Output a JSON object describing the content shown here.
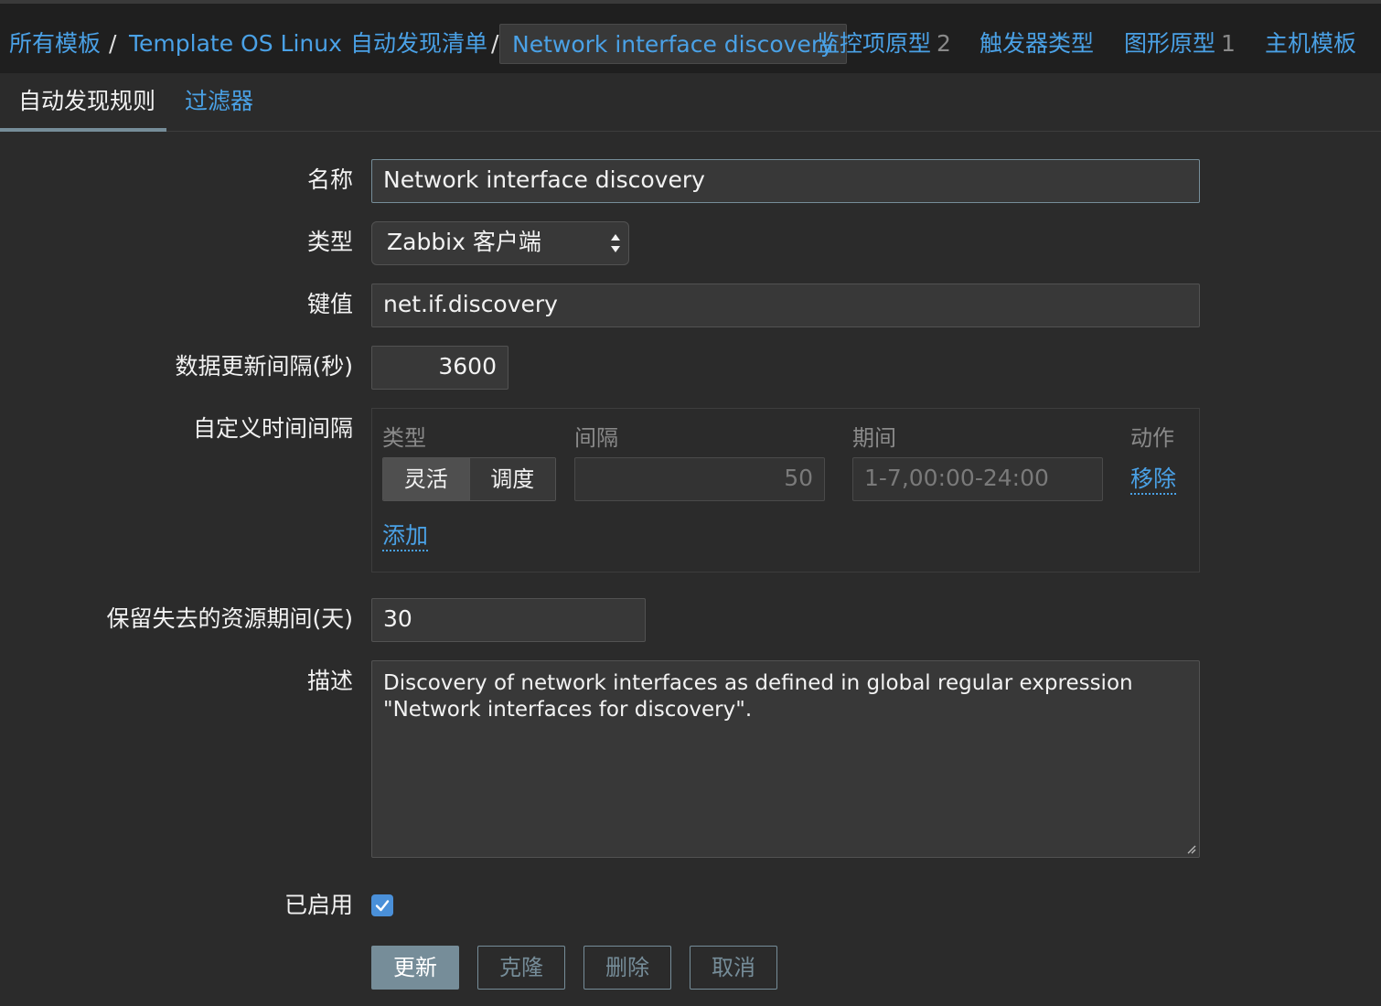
{
  "breadcrumb": {
    "all_templates": "所有模板",
    "sep": "/",
    "template": "Template OS Linux",
    "discovery_list": "自动发现清单",
    "current": "Network interface discovery",
    "item_prototypes": "监控项原型",
    "item_prototypes_count": "2",
    "trigger_types": "触发器类型",
    "graph_prototypes": "图形原型",
    "graph_prototypes_count": "1",
    "host_templates": "主机模板"
  },
  "tabs": {
    "rule": "自动发现规则",
    "filters": "过滤器"
  },
  "form": {
    "name_label": "名称",
    "name_value": "Network interface discovery",
    "type_label": "类型",
    "type_value": "Zabbix 客户端",
    "key_label": "键值",
    "key_value": "net.if.discovery",
    "interval_label": "数据更新间隔(秒)",
    "interval_value": "3600",
    "custom_label": "自定义时间间隔",
    "custom": {
      "col_type": "类型",
      "col_interval": "间隔",
      "col_period": "期间",
      "col_action": "动作",
      "seg_flexible": "灵活",
      "seg_scheduling": "调度",
      "interval_placeholder": "50",
      "period_placeholder": "1-7,00:00-24:00",
      "remove": "移除",
      "add": "添加"
    },
    "keep_lost_label": "保留失去的资源期间(天)",
    "keep_lost_value": "30",
    "desc_label": "描述",
    "desc_value": "Discovery of network interfaces as defined in global regular expression \"Network interfaces for discovery\".",
    "enabled_label": "已启用",
    "enabled_checked": true
  },
  "buttons": {
    "update": "更新",
    "clone": "克隆",
    "delete": "删除",
    "cancel": "取消"
  },
  "colors": {
    "link": "#4aa1e6",
    "background": "#2b2b2b",
    "header": "#1f1f1f",
    "accent": "#768d99",
    "checkbox": "#4a90d9"
  }
}
